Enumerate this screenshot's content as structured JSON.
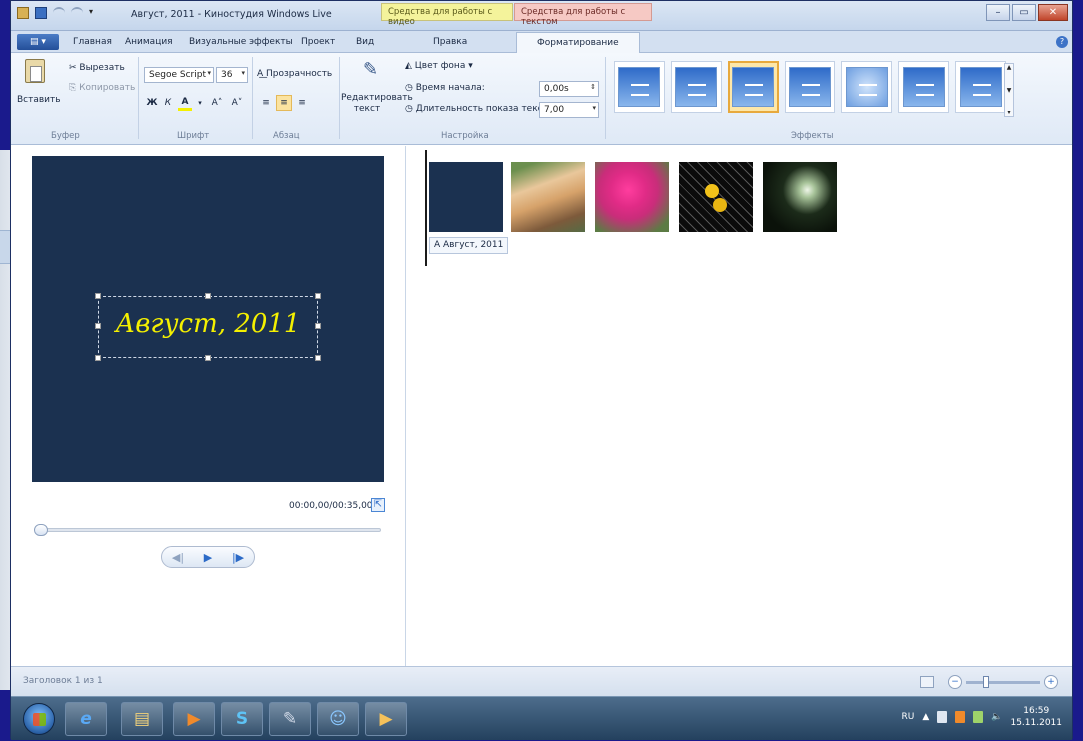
{
  "window": {
    "title": "Август, 2011 - Киностудия Windows Live",
    "context_tabs": {
      "video": "Средства для работы с видео",
      "text": "Средства для работы с текстом"
    },
    "controls": {
      "minimize": "–",
      "maximize": "▭",
      "close": "✕"
    }
  },
  "tabs": {
    "file": "▤ ▾",
    "items": [
      "Главная",
      "Анимация",
      "Визуальные эффекты",
      "Проект",
      "Вид",
      "Правка",
      "Форматирование"
    ],
    "active": "Форматирование",
    "help": "?"
  },
  "ribbon": {
    "clipboard": {
      "paste": "Вставить",
      "cut": "Вырезать",
      "copy": "Копировать",
      "group": "Буфер"
    },
    "font": {
      "family": "Segoe Script",
      "size": "36",
      "bold": "Ж",
      "italic": "К",
      "color": "A",
      "grow": "A˄",
      "shrink": "A˅",
      "group": "Шрифт"
    },
    "paragraph": {
      "transparency": "Прозрачность",
      "align_left": "≡",
      "align_center": "≡",
      "align_right": "≡",
      "group": "Абзац"
    },
    "adjust": {
      "edit_text": "Редактировать текст",
      "bg_color": "Цвет фона ▾",
      "start_time_label": "Время начала:",
      "start_time_value": "0,00s",
      "duration_label": "Длительность показа текста:",
      "duration_value": "7,00",
      "group": "Настройка"
    },
    "effects": {
      "group": "Эффекты",
      "count": 7,
      "selected_index": 2
    }
  },
  "preview": {
    "title_text": "Август, 2011",
    "timecode": "00:00,00/00:35,00",
    "seek_position": 0.0,
    "player": {
      "prev": "◀|",
      "play": "▶",
      "next": "|▶"
    }
  },
  "storyboard": {
    "title_caption": "A Август, 2011",
    "clips": [
      "title-clip",
      "flower-clip-1",
      "flower-clip-2",
      "flower-clip-3",
      "flower-clip-4"
    ]
  },
  "status": {
    "text": "Заголовок 1 из 1",
    "zoom_out": "−",
    "zoom_in": "+",
    "zoom_level": 0.25
  },
  "taskbar": {
    "apps": [
      "ie-icon",
      "explorer-icon",
      "media-icon",
      "skype-icon",
      "paint-icon",
      "messenger-icon",
      "movie-maker-icon"
    ],
    "app_glyphs": [
      "e",
      "▤",
      "▶",
      "S",
      "✎",
      "☺",
      "▶"
    ],
    "language": "RU",
    "tray_arrow": "▲",
    "time": "16:59",
    "date": "15.11.2011"
  },
  "colors": {
    "accent": "#2b6ac7",
    "title_text": "#f4f000",
    "monitor_bg": "#1b3150"
  }
}
